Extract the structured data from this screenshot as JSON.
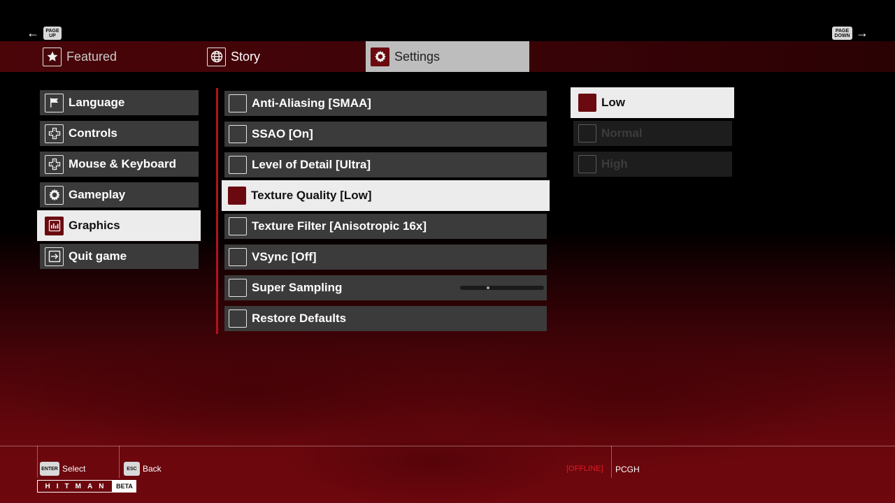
{
  "nav": {
    "page_up_key": "PAGE UP",
    "page_down_key": "PAGE DOWN",
    "tabs": [
      {
        "label": "Featured",
        "icon": "star-icon",
        "active": false
      },
      {
        "label": "Story",
        "icon": "globe-icon",
        "active": false
      },
      {
        "label": "Settings",
        "icon": "gear-icon",
        "active": true
      }
    ]
  },
  "left_menu": {
    "items": [
      {
        "label": "Language",
        "icon": "flag-icon"
      },
      {
        "label": "Controls",
        "icon": "dpad-icon"
      },
      {
        "label": "Mouse & Keyboard",
        "icon": "dpad-icon"
      },
      {
        "label": "Gameplay",
        "icon": "gear-icon"
      },
      {
        "label": "Graphics",
        "icon": "graphics-icon",
        "active": true
      },
      {
        "label": "Quit game",
        "icon": "exit-icon"
      }
    ]
  },
  "options": {
    "items": [
      {
        "label": "Anti-Aliasing [SMAA]"
      },
      {
        "label": "SSAO [On]"
      },
      {
        "label": "Level of Detail [Ultra]"
      },
      {
        "label": "Texture Quality [Low]",
        "active": true
      },
      {
        "label": "Texture Filter [Anisotropic 16x]"
      },
      {
        "label": "VSync [Off]"
      },
      {
        "label": "Super Sampling",
        "slider_value": 0.33
      },
      {
        "label": "Restore Defaults"
      }
    ]
  },
  "choices": {
    "items": [
      {
        "label": "Low",
        "active": true
      },
      {
        "label": "Normal",
        "active": false
      },
      {
        "label": "High",
        "active": false
      }
    ]
  },
  "footer": {
    "select_key": "ENTER",
    "select_label": "Select",
    "back_key": "ESC",
    "back_label": "Back",
    "status": "[OFFLINE]",
    "user": "PCGH",
    "logo_text": "HITMAN",
    "logo_badge": "BETA"
  },
  "colors": {
    "accent": "#6a0a10",
    "offline": "#e31b23"
  }
}
